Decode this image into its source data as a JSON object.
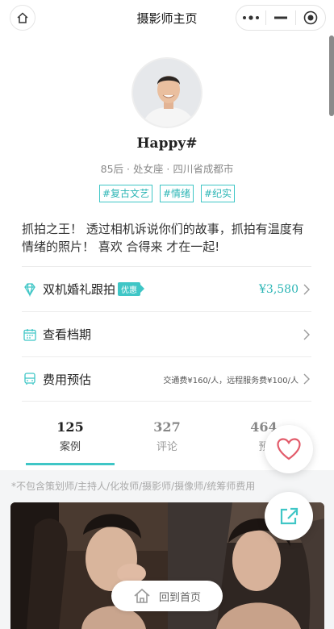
{
  "window": {
    "title": "摄影师主页"
  },
  "profile": {
    "name": "Happy#",
    "meta": "85后 · 处女座 · 四川省成都市",
    "tags": [
      "#复古文艺",
      "#情绪",
      "#纪实"
    ],
    "bio": "抓拍之王！ 透过相机诉说你们的故事，抓拍有温度有情绪的照片！ 喜欢 合得来 才在一起!"
  },
  "rows": {
    "package": {
      "label": "双机婚礼跟拍",
      "badge": "优惠",
      "price": "¥3,580"
    },
    "schedule": {
      "label": "查看档期"
    },
    "fees": {
      "label": "费用预估",
      "note": "交通费¥160/人，远程服务费¥100/人"
    }
  },
  "tabs": [
    {
      "count": "125",
      "label": "案例"
    },
    {
      "count": "327",
      "label": "评论"
    },
    {
      "count": "464",
      "label": "预"
    }
  ],
  "notice": "*不包含策划师/主持人/化妆师/摄影师/摄像师/统筹师费用",
  "back_home": {
    "label": "回到首页"
  },
  "colors": {
    "accent": "#3fc6c6",
    "fav": "#e25b6a"
  },
  "icons": [
    "home-icon",
    "more-icon",
    "minimize-icon",
    "target-icon",
    "gem-icon",
    "calendar-icon",
    "bus-icon",
    "chevron-right-icon",
    "heart-icon",
    "share-icon"
  ]
}
